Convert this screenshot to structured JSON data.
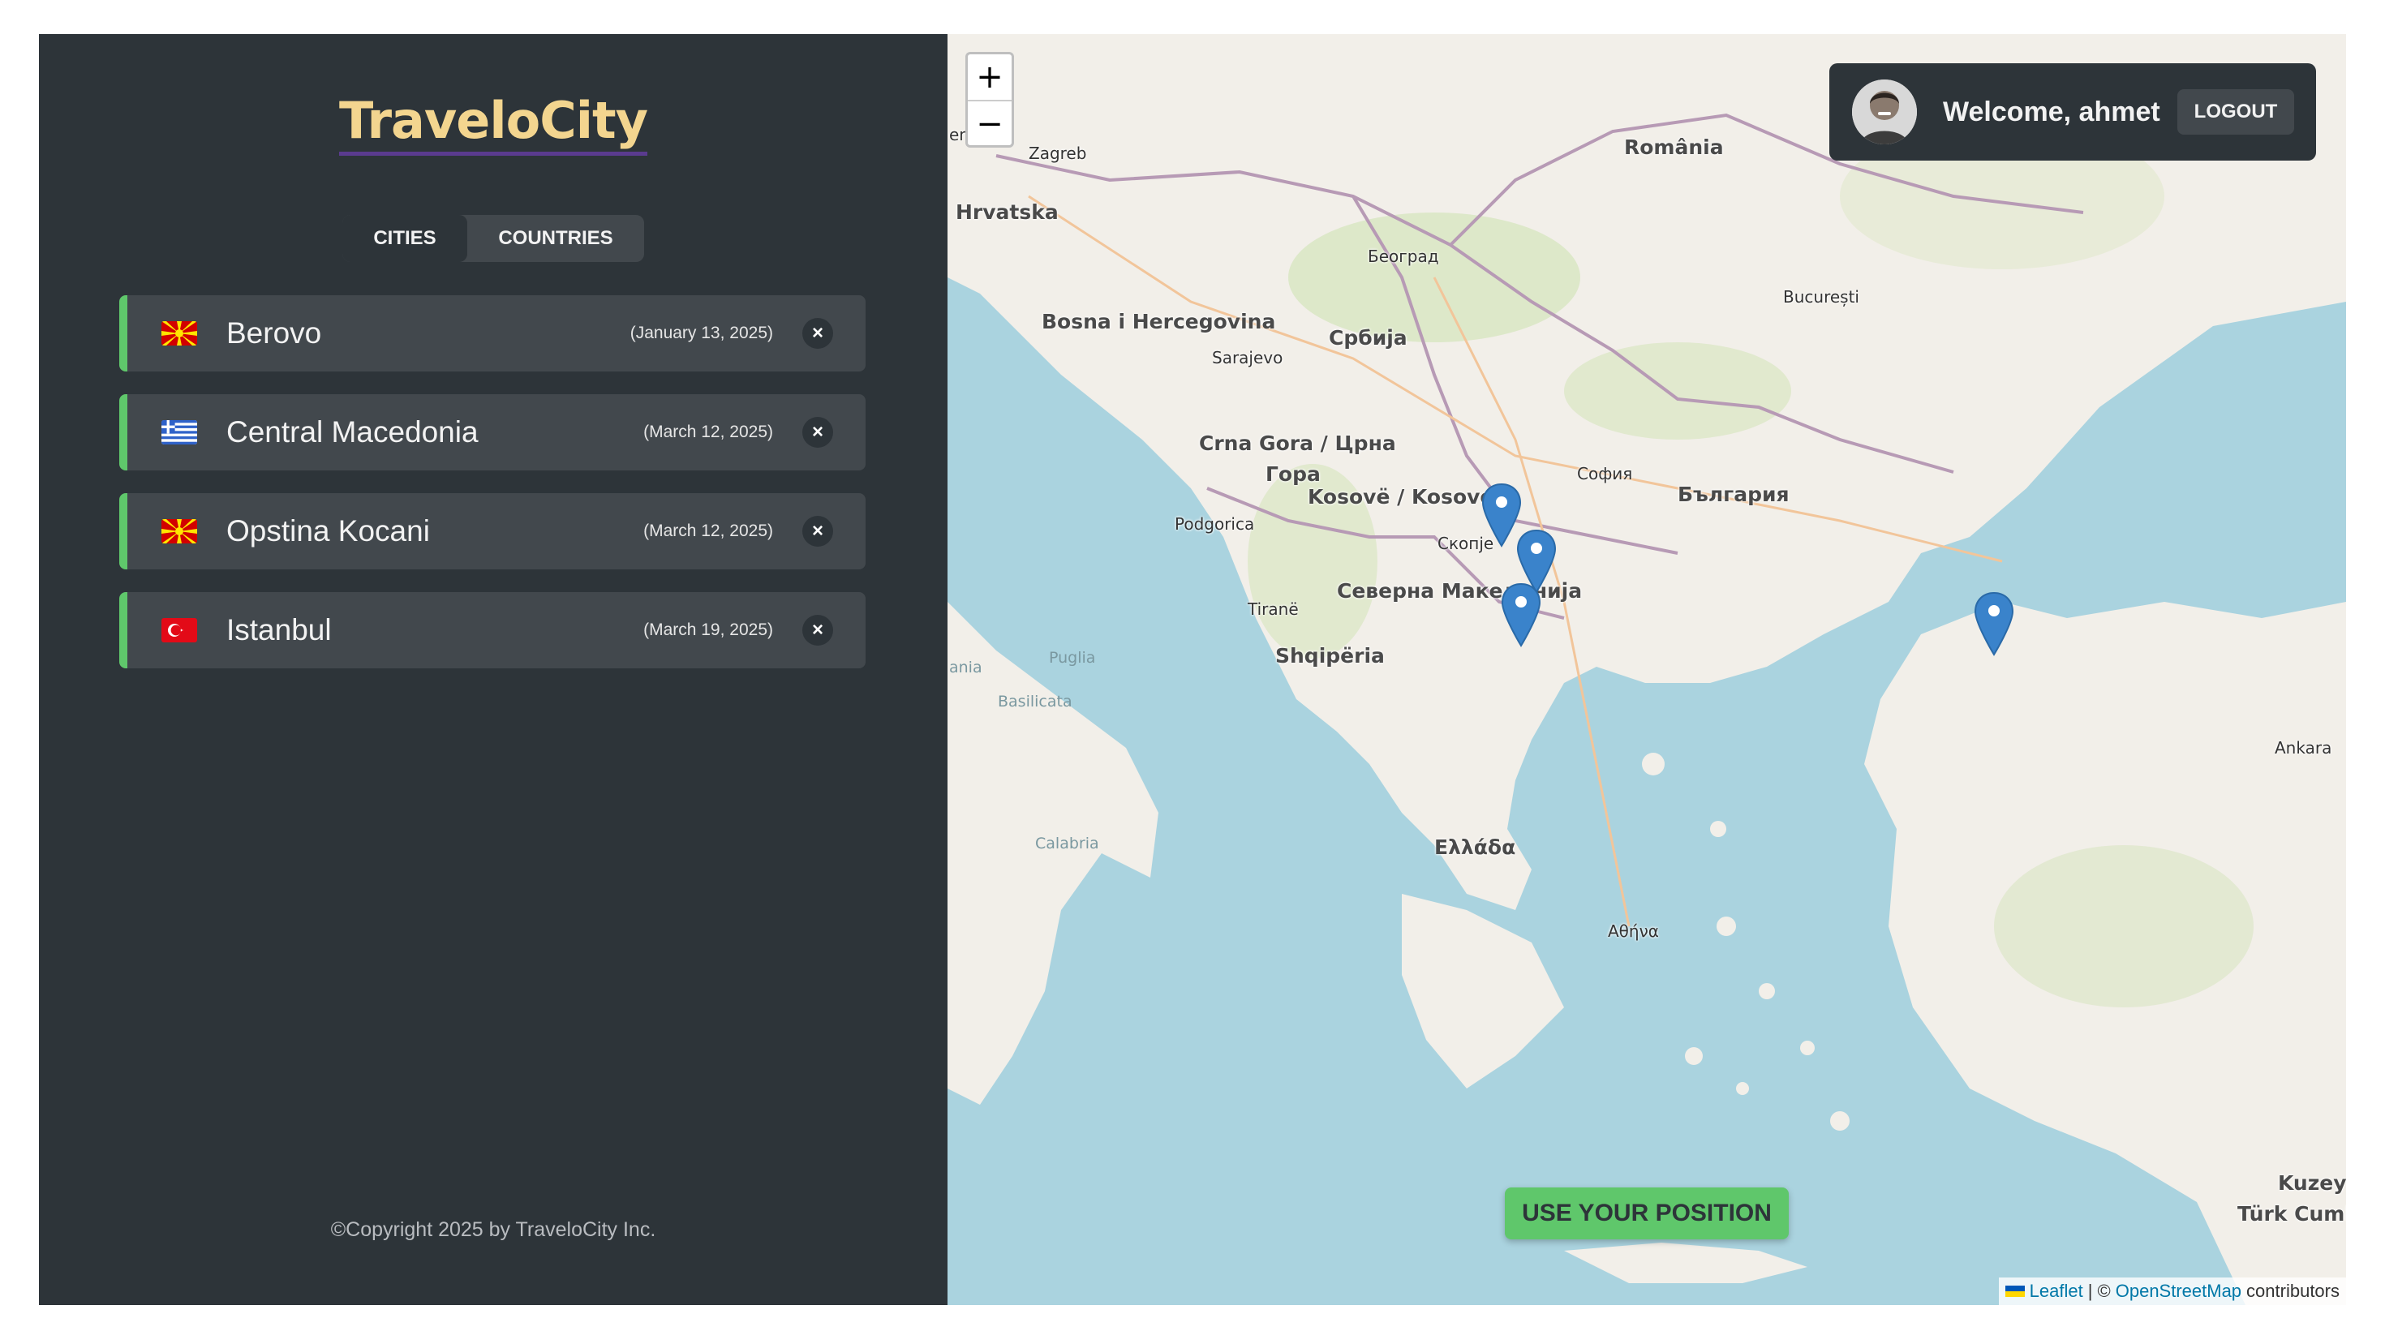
{
  "app": {
    "title": "TraveloCity"
  },
  "tabs": {
    "cities": "CITIES",
    "countries": "COUNTRIES",
    "active": "cities"
  },
  "cities": [
    {
      "name": "Berovo",
      "date": "(January 13, 2025)",
      "flag": "macedonia-flag-icon"
    },
    {
      "name": "Central Macedonia",
      "date": "(March 12, 2025)",
      "flag": "greece-flag-icon"
    },
    {
      "name": "Opstina Kocani",
      "date": "(March 12, 2025)",
      "flag": "macedonia-flag-icon"
    },
    {
      "name": "Istanbul",
      "date": "(March 19, 2025)",
      "flag": "turkey-flag-icon"
    }
  ],
  "delete_symbol": "×",
  "footer": {
    "copyright": "©Copyright 2025 by TraveloCity Inc."
  },
  "user": {
    "welcome": "Welcome, ahmet",
    "logout": "LOGOUT"
  },
  "map": {
    "zoom_in": "+",
    "zoom_out": "−",
    "use_position": "USE YOUR POSITION",
    "attribution": {
      "leaflet": "Leaflet",
      "separator": "| ©",
      "osm": "OpenStreetMap",
      "contributors": "contributors"
    },
    "labels": {
      "zagreb": "Zagreb",
      "hrvatska": "Hrvatska",
      "romania": "România",
      "beograd": "Београд",
      "bucuresti": "București",
      "bosna": "Bosna i Hercegovina",
      "srbija": "Србија",
      "sarajevo": "Sarajevo",
      "crna_gora": "Crna Gora / Црна",
      "gora": "Гора",
      "kosovo": "Kosovë / Kosovo",
      "sofia": "София",
      "bulgaria": "България",
      "podgorica": "Podgorica",
      "skopje": "Скопје",
      "tirane": "Tiranë",
      "sev_makedonija": "Северна Македонија",
      "shqiperia": "Shqipëria",
      "puglia": "Puglia",
      "basilicata": "Basilicata",
      "calabria": "Calabria",
      "ellada": "Ελλάδα",
      "athina": "Αθήνα",
      "ankara": "Ankara",
      "kuzey": "Kuzey K",
      "turk_cum": "Türk Cumh",
      "en": "en",
      "ania": "ania"
    },
    "markers": 4
  },
  "colors": {
    "sidebar": "#2d3439",
    "accent": "#5fc76b",
    "logo": "#f3d58f",
    "sea": "#aad3df",
    "land": "#f2efe9"
  }
}
